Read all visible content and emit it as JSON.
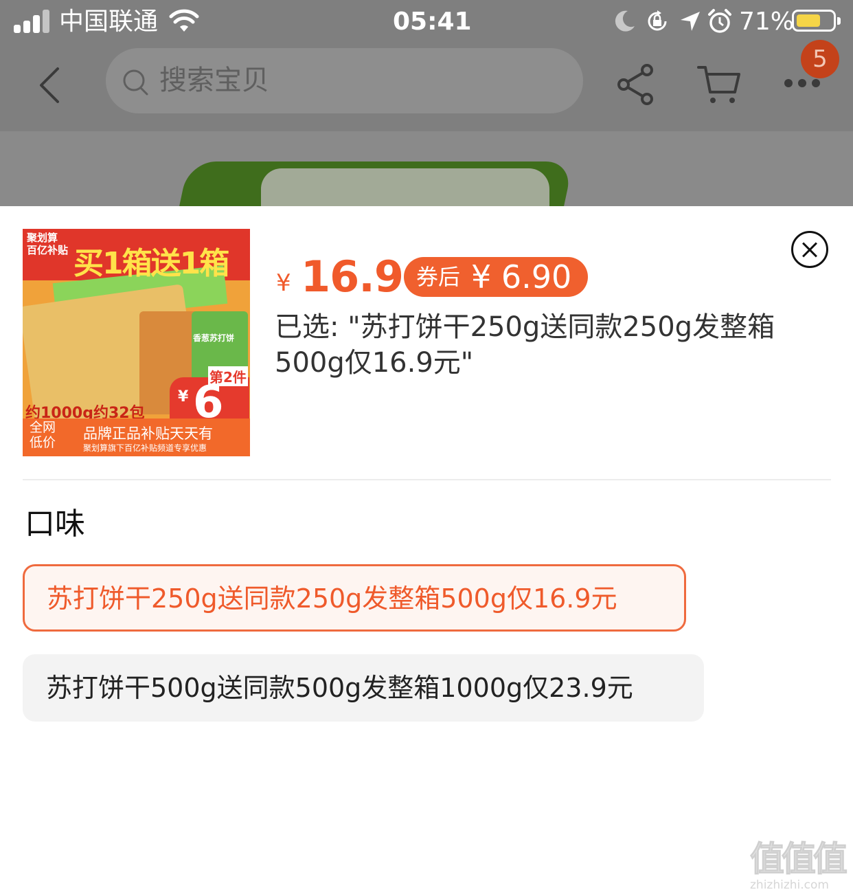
{
  "status_bar": {
    "carrier": "中国联通",
    "time": "05:41",
    "battery": "71%",
    "battery_level": 0.71
  },
  "nav": {
    "search_placeholder": "搜索宝贝",
    "cart_badge": "5"
  },
  "product": {
    "image_texts": {
      "campaign": "聚划算",
      "subsidy": "百亿补贴",
      "headline": "买1箱送1箱",
      "package_name": "香葱苏打饼",
      "second_item": "第2件",
      "second_currency": "¥",
      "second_price": "6",
      "count_text": "约1000g约32包",
      "lowest": "全网低价",
      "brand_line": "品牌正品补贴天天有",
      "footer_sub": "聚划算旗下百亿补贴频道专享优惠"
    },
    "currency": "¥",
    "price": "16.9",
    "coupon_label": "券后",
    "coupon_price": "¥ 6.90",
    "selected_text": "已选: \"苏打饼干250g送同款250g发整箱500g仅16.9元\""
  },
  "options": {
    "section_title": "口味",
    "items": [
      {
        "label": "苏打饼干250g送同款250g发整箱500g仅16.9元",
        "selected": true
      },
      {
        "label": "苏打饼干500g送同款500g发整箱1000g仅23.9元",
        "selected": false
      }
    ]
  },
  "watermark": {
    "mark": "值值值",
    "site": "zhizhizhi.com"
  },
  "colors": {
    "accent": "#f05a2b",
    "coupon_bg": "#f0602e",
    "dim_overlay": "#7f7f7f",
    "battery_fill": "#f5d547"
  }
}
